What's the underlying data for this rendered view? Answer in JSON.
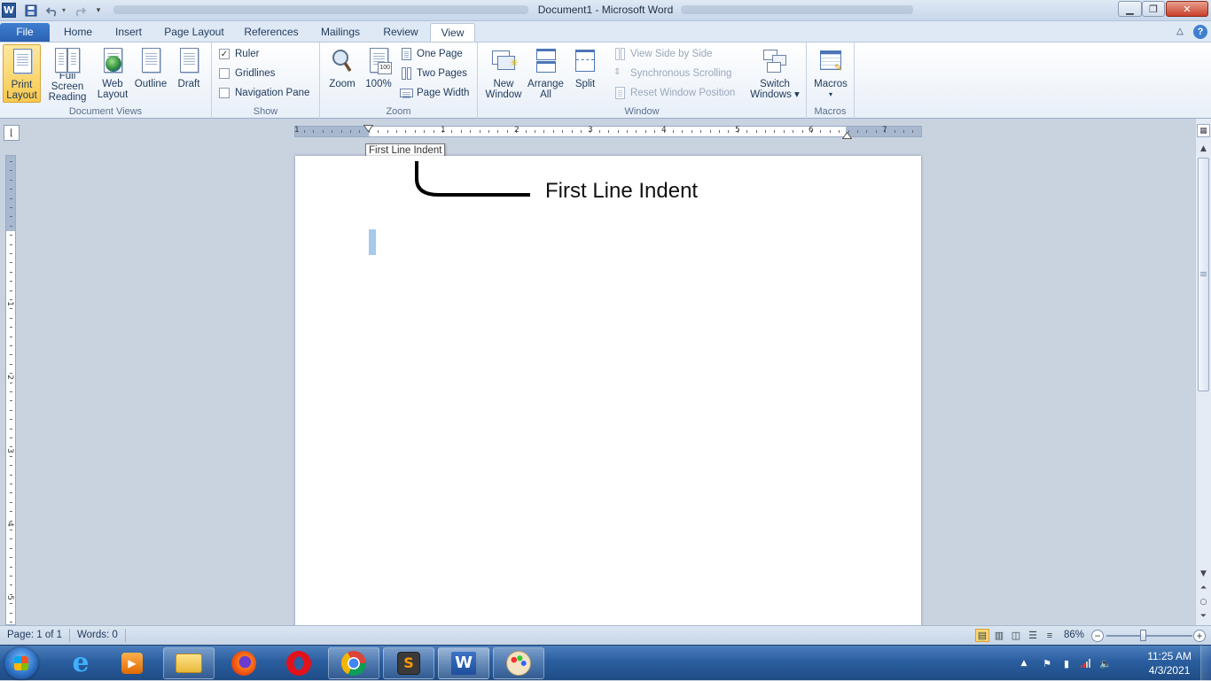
{
  "window": {
    "title": "Document1 - Microsoft Word",
    "app_logo": "W"
  },
  "tabs": [
    "File",
    "Home",
    "Insert",
    "Page Layout",
    "References",
    "Mailings",
    "Review",
    "View"
  ],
  "ribbon": {
    "document_views": {
      "label": "Document Views",
      "buttons": [
        {
          "line1": "Print",
          "line2": "Layout"
        },
        {
          "line1": "Full Screen",
          "line2": "Reading"
        },
        {
          "line1": "Web",
          "line2": "Layout"
        },
        {
          "line1": "Outline",
          "line2": ""
        },
        {
          "line1": "Draft",
          "line2": ""
        }
      ]
    },
    "show": {
      "label": "Show",
      "ruler": "Ruler",
      "gridlines": "Gridlines",
      "navigation_pane": "Navigation Pane"
    },
    "zoom": {
      "label": "Zoom",
      "zoom": "Zoom",
      "hundred": "100%",
      "one_page": "One Page",
      "two_pages": "Two Pages",
      "page_width": "Page Width"
    },
    "window": {
      "label": "Window",
      "new_window_1": "New",
      "new_window_2": "Window",
      "arrange_1": "Arrange",
      "arrange_2": "All",
      "split": "Split",
      "view_side_by_side": "View Side by Side",
      "synchronous_scrolling": "Synchronous Scrolling",
      "reset_window_position": "Reset Window Position",
      "switch_1": "Switch",
      "switch_2": "Windows"
    },
    "macros": {
      "label": "Macros",
      "button": "Macros"
    }
  },
  "ruler": {
    "numbers": [
      "1",
      "1",
      "2",
      "3",
      "4",
      "5",
      "6",
      "7"
    ],
    "vnumbers": [
      "1",
      "2",
      "3",
      "4",
      "5"
    ]
  },
  "tooltip": "First Line Indent",
  "annotation": "First Line Indent",
  "status": {
    "page": "Page: 1 of 1",
    "words": "Words: 0",
    "zoom": "86%"
  },
  "taskbar": {
    "time": "11:25 AM",
    "date": "4/3/2021"
  }
}
